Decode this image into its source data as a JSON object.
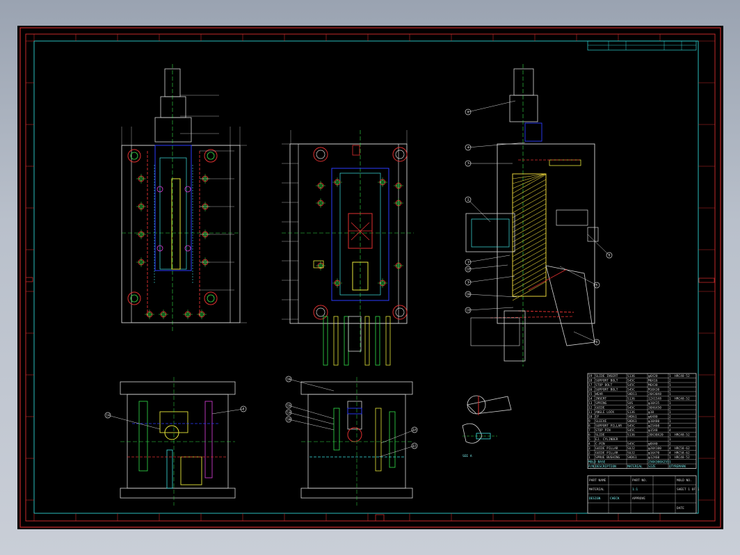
{
  "colors": {
    "background": "#000000",
    "frame": "#c42a2a",
    "inner_frame": "#2fd3d3",
    "plate": "#d8d8d8",
    "green": "#34e34a",
    "yellow": "#e8e83a",
    "blue": "#2b3cff",
    "red": "#e03030",
    "magenta": "#e040e0",
    "cyan": "#3ee3e3",
    "hatch": "#e6d23a"
  },
  "drawing": {
    "balloons_right": [
      "6",
      "4",
      "7",
      "2",
      "1",
      "12",
      "3",
      "10",
      "11",
      "5",
      "8",
      "9"
    ],
    "balloons_bottom": [
      "17",
      "8",
      "16",
      "15",
      "13",
      "18",
      "14"
    ],
    "section_label": "SEE A",
    "bom_rows": [
      {
        "no": "19",
        "name": "SLIDE INSERT",
        "mat": "S136",
        "size": "φ6X20",
        "qty": "1",
        "remark": "HRC48-52"
      },
      {
        "no": "18",
        "name": "SUPPORT BOLT",
        "mat": "S45C",
        "size": "M6X16",
        "qty": "2",
        "remark": ""
      },
      {
        "no": "17",
        "name": "STOP BOLT",
        "mat": "S45C",
        "size": "M6X30",
        "qty": "1",
        "remark": ""
      },
      {
        "no": "16",
        "name": "SUPPORT BOLT",
        "mat": "S45C",
        "size": "M10X30",
        "qty": "1",
        "remark": ""
      },
      {
        "no": "15",
        "name": "WEAR",
        "mat": "SKD11",
        "size": "20X30X8",
        "qty": "1",
        "remark": ""
      },
      {
        "no": "14",
        "name": "INSERT",
        "mat": "S136",
        "size": "12X15X8",
        "qty": "1",
        "remark": "HRC48-52"
      },
      {
        "no": "13",
        "name": "SPRING",
        "mat": "SUS",
        "size": "φ10X35",
        "qty": "1",
        "remark": ""
      },
      {
        "no": "12",
        "name": "GUIDE",
        "mat": "S45C",
        "size": "30X6X50",
        "qty": "2",
        "remark": ""
      },
      {
        "no": "11",
        "name": "ANGLE LOCK",
        "mat": "S136",
        "size": "φ10",
        "qty": "1",
        "remark": ""
      },
      {
        "no": "10",
        "name": "EF",
        "mat": "SKD61",
        "size": "φ6X80",
        "qty": "2",
        "remark": ""
      },
      {
        "no": "9",
        "name": "SLEEVE",
        "mat": "SKD61",
        "size": "φ10X80",
        "qty": "1",
        "remark": ""
      },
      {
        "no": "8",
        "name": "SUPPORT PILLAR",
        "mat": "S45C",
        "size": "φ25X60",
        "qty": "4",
        "remark": ""
      },
      {
        "no": "7",
        "name": "STOP PIN",
        "mat": "S45C",
        "size": "φ15X8",
        "qty": "4",
        "remark": ""
      },
      {
        "no": "6",
        "name": "SLIDE",
        "mat": "S136",
        "size": "20X30X20",
        "qty": "1",
        "remark": "HRC48-52"
      },
      {
        "no": "5",
        "name": "EJ. CYLINDER",
        "mat": "",
        "size": "",
        "qty": "1",
        "remark": ""
      },
      {
        "no": "4",
        "name": "C-PIN",
        "mat": "S45C",
        "size": "φ8X40",
        "qty": "2",
        "remark": ""
      },
      {
        "no": "3",
        "name": "GUIDE PILLAR",
        "mat": "SUJ2",
        "size": "φ20X100",
        "qty": "4",
        "remark": "HRC58-62"
      },
      {
        "no": "2",
        "name": "GUIDE PILLAR",
        "mat": "SUJ2",
        "size": "φ16X70",
        "qty": "4",
        "remark": "HRC58-62"
      },
      {
        "no": "1",
        "name": "SPRUE BUSHING",
        "mat": "SKD61",
        "size": "φ12X60",
        "qty": "1",
        "remark": "HRC48-52"
      }
    ],
    "bom_footer": {
      "no": "MOLD BASE",
      "name": "",
      "mat": "",
      "size": "250X300X255",
      "qty": "1",
      "remark": ""
    },
    "bom_header": {
      "no": "P/N",
      "name": "DESCRIPTION",
      "mat": "MATERIAL",
      "size": "SIZE",
      "qty": "QTY",
      "remark": "REMARK"
    },
    "title_block": {
      "part_name": "PART NAME",
      "part_no": "PART NO.",
      "mold_no": "MOLD NO.",
      "scale": "1:1",
      "sheet": "SHEET 1 OF 1",
      "material": "MATERIAL",
      "designer": "DESIGN",
      "checker": "CHECK",
      "approver": "APPROVE",
      "date": "DATE"
    }
  }
}
